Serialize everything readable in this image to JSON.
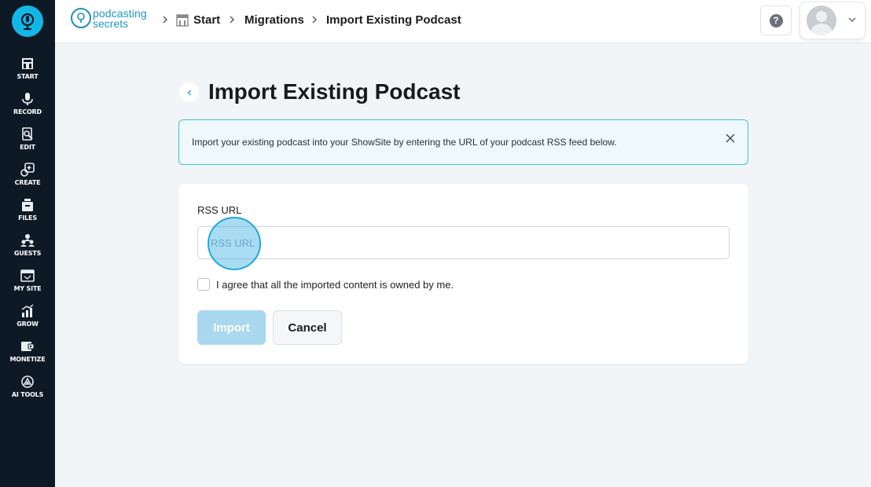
{
  "sidebar": {
    "items": [
      {
        "label": "START",
        "icon": "start-icon"
      },
      {
        "label": "RECORD",
        "icon": "microphone-icon"
      },
      {
        "label": "EDIT",
        "icon": "edit-icon"
      },
      {
        "label": "CREATE",
        "icon": "create-icon"
      },
      {
        "label": "FILES",
        "icon": "files-icon"
      },
      {
        "label": "GUESTS",
        "icon": "guests-icon"
      },
      {
        "label": "MY SITE",
        "icon": "my-site-icon"
      },
      {
        "label": "GROW",
        "icon": "grow-icon"
      },
      {
        "label": "MONETIZE",
        "icon": "monetize-icon"
      },
      {
        "label": "AI TOOLS",
        "icon": "ai-tools-icon"
      }
    ]
  },
  "header": {
    "brand_line1": "podcasting",
    "brand_line2": "secrets",
    "breadcrumbs": [
      "Start",
      "Migrations",
      "Import Existing Podcast"
    ],
    "help_label": "?"
  },
  "main": {
    "title": "Import Existing Podcast",
    "info": "Import your existing podcast into your ShowSite by entering the URL of your podcast RSS feed below.",
    "form": {
      "rss_label": "RSS URL",
      "rss_placeholder": "RSS URL",
      "rss_value": "",
      "agree_label": "I agree that all the imported content is owned by me.",
      "import_label": "Import",
      "cancel_label": "Cancel"
    }
  },
  "colors": {
    "sidebar_bg": "#0d1a26",
    "accent": "#13b7e6",
    "import_disabled": "#a9d8ef",
    "info_border": "#43c0d6"
  }
}
